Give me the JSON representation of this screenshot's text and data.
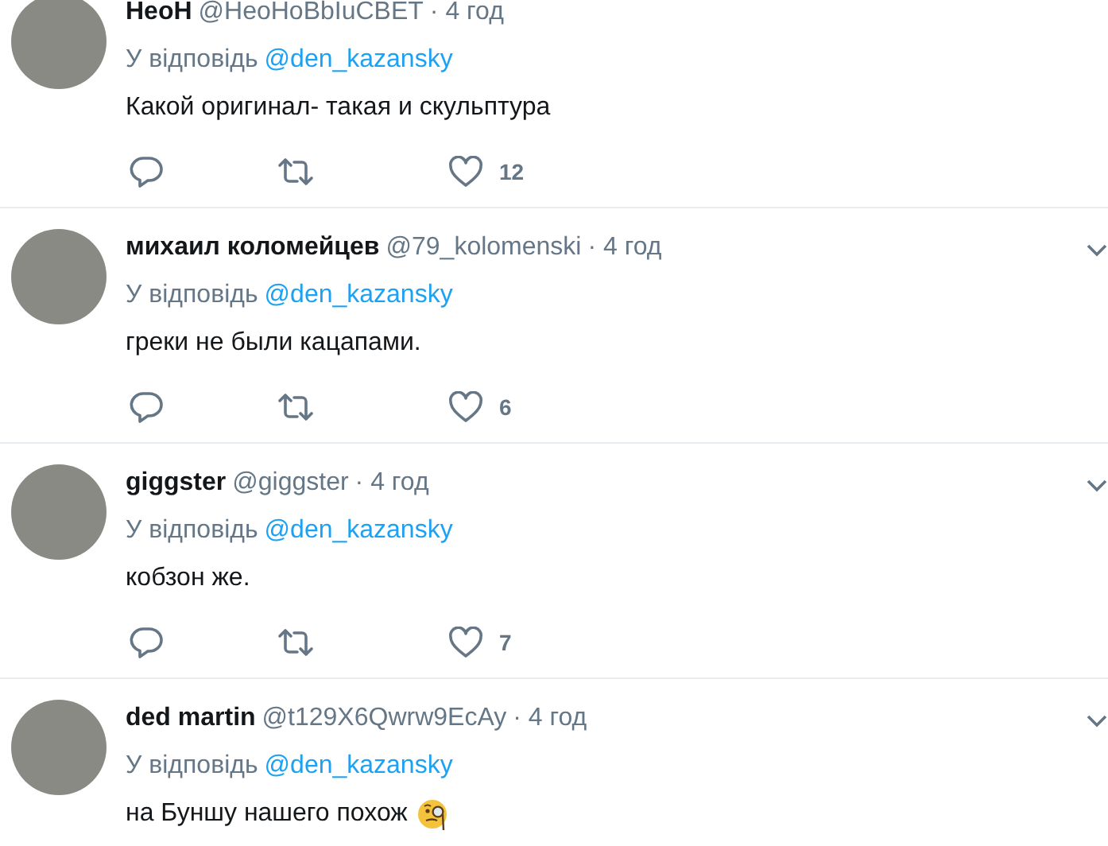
{
  "tweets": [
    {
      "name": "НеоН",
      "handle": "@НеоНоВbIuСВЕТ",
      "time": "· 4 год",
      "reply_prefix": "У відповідь",
      "reply_to": "@den_kazansky",
      "text": "Какой оригинал- такая и скульптура",
      "likes": "12",
      "caret": false,
      "emoji": false
    },
    {
      "name": "михаил коломейцев",
      "handle": "@79_kolomenski",
      "time": "· 4 год",
      "reply_prefix": "У відповідь",
      "reply_to": "@den_kazansky",
      "text": "греки не были кацапами.",
      "likes": "6",
      "caret": true,
      "emoji": false
    },
    {
      "name": "giggster",
      "handle": "@giggster",
      "time": "· 4 год",
      "reply_prefix": "У відповідь",
      "reply_to": "@den_kazansky",
      "text": "кобзон же.",
      "likes": "7",
      "caret": true,
      "emoji": false
    },
    {
      "name": "ded martin",
      "handle": "@t129X6Qwrw9EcAy",
      "time": "· 4 год",
      "reply_prefix": "У відповідь",
      "reply_to": "@den_kazansky",
      "text": "на Буншу нашего похож",
      "caret": true,
      "emoji": true
    }
  ]
}
